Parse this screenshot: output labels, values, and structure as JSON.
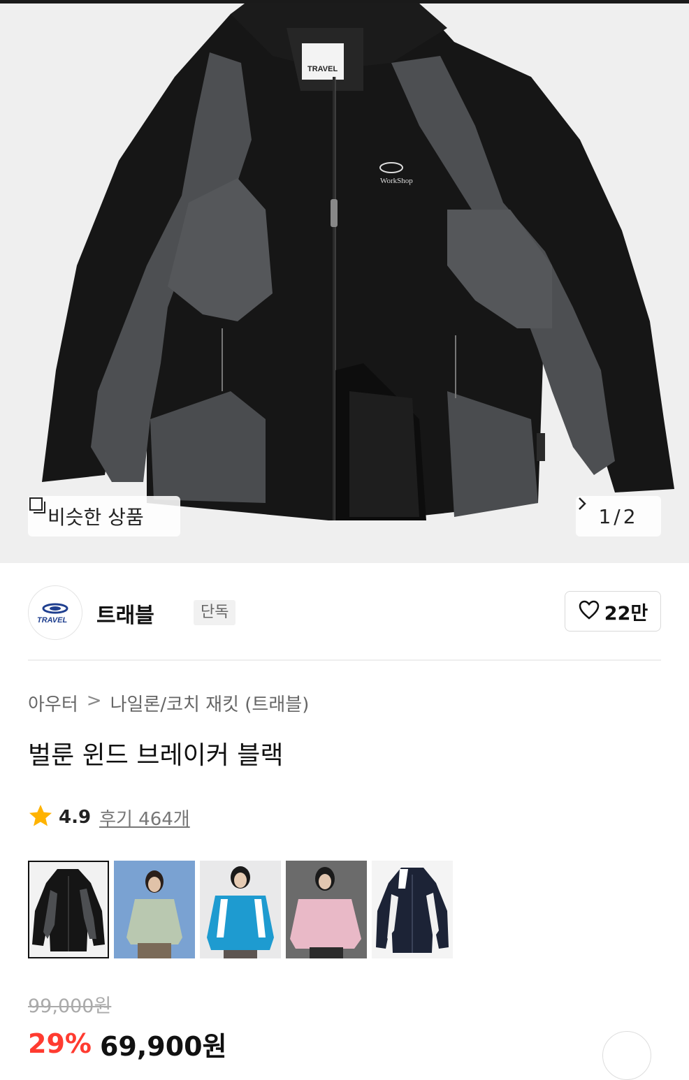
{
  "hero": {
    "similar_label": "비슷한 상품",
    "pager": {
      "current": "1",
      "separator": "/",
      "total": "2"
    },
    "jacket_label": "TRAVEL",
    "jacket_chest_logo": "WorkShop"
  },
  "brand": {
    "logo_text": "TRAVEL",
    "name": "트래블",
    "badge": "단독",
    "likes": "22만"
  },
  "breadcrumb": {
    "items": [
      "아우터",
      "나일론/코치 재킷 (트래블)"
    ],
    "separator": ">"
  },
  "product": {
    "title": "벌룬 윈드 브레이커 블랙",
    "rating": "4.9",
    "reviews": "후기 464개"
  },
  "thumbnails": [
    {
      "name": "black-grey",
      "selected": true
    },
    {
      "name": "mint-model",
      "selected": false
    },
    {
      "name": "blue-model",
      "selected": false
    },
    {
      "name": "pink-model",
      "selected": false
    },
    {
      "name": "navy-white",
      "selected": false
    }
  ],
  "price": {
    "original": "99,000원",
    "discount": "29%",
    "sale": "69,900원"
  },
  "colors": {
    "star": "#ffb300",
    "discount": "#ff3b30"
  }
}
